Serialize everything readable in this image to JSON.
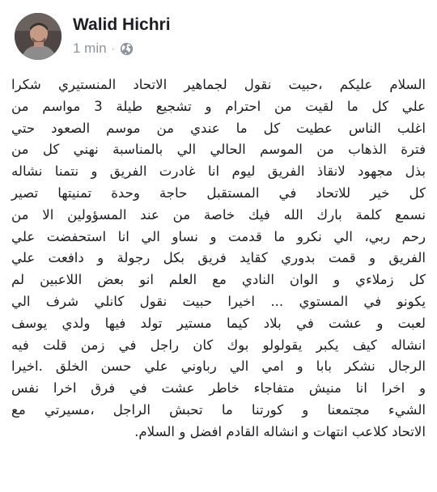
{
  "post": {
    "author": {
      "name": "Walid Hichri",
      "avatar_icon": "profile-photo"
    },
    "timestamp": "1 min",
    "separator": "·",
    "audience_icon": "globe-icon",
    "colors": {
      "text": "#1c1e21",
      "meta": "#8d949e"
    },
    "body_lines": [
      "السلام عليكم ،حبيت نقول لجماهير الاتحاد المنستيري شكرا",
      "علي كل ما لقيت من احترام و تشجيع طيلة 3 مواسم من",
      "اغلب الناس عطيت كل ما عندي من موسم الصعود حتي",
      "فترة الذهاب من الموسم الحالي الي بالمناسبة نهني كل من",
      "بذل مجهود لانقاذ الفريق ليوم انا غادرت الفريق و نتمنا نشاله",
      "كل خير للاتحاد في المستقبل حاجة وحدة تمنيتها تصير",
      "نسمع كلمة بارك الله فيك خاصة من عند المسؤولين الا من",
      "رحم ربي، الي نكرو ما قدمت و نساو الي انا استحفضت علي",
      "الفريق و قمت بدوري كقايد فريق بكل رجولة و دافعت علي",
      "كل زملاءي و الوان النادي مع العلم انو بعض اللاعبين لم",
      "يكونو في المستوي ... اخيرا حبيت نقول كانلي شرف الي",
      "لعبت و عشت في بلاد كيما مستير تولد فيها ولدي يوسف",
      "انشاله كيف يكبر يقولولو بوك كان راجل في زمن قلت فيه",
      "الرجال نشكر بابا و امي الي رباوني علي حسن الخلق .اخيرا",
      "و اخرا انا منيش متفاجاء خاطر عشت في فرق اخرا نفس",
      "الشيء مجتمعنا و كورتنا ما تحبش الراجل ،مسيرتي مع",
      "الاتحاد كلاعب انتهات و انشاله القادم افضل و السلام."
    ]
  }
}
